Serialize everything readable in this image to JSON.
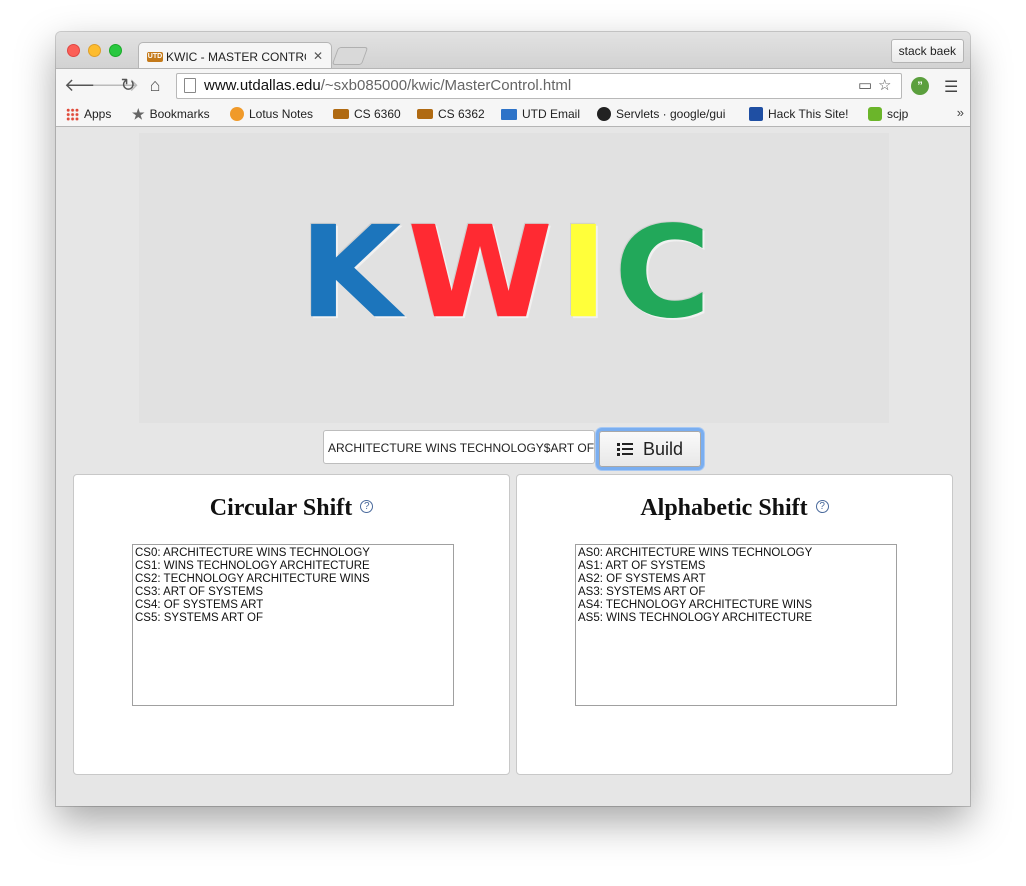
{
  "browser": {
    "tab_title": "KWIC - MASTER CONTROL",
    "tab_favicon_text": "UTD",
    "profile_name": "stack baek",
    "url_host": "www.utdallas.edu",
    "url_path": "/~sxb085000/kwic/MasterControl.html",
    "bookmarks": [
      {
        "label": "Apps",
        "icon": "apps-grid-icon"
      },
      {
        "label": "Bookmarks",
        "icon": "star-icon"
      },
      {
        "label": "Lotus Notes",
        "icon": "lotus-icon"
      },
      {
        "label": "CS 6360",
        "icon": "utd-icon"
      },
      {
        "label": "CS 6362",
        "icon": "utd-icon"
      },
      {
        "label": "UTD Email",
        "icon": "mail-icon"
      },
      {
        "label": "Servlets · google/gui",
        "icon": "github-icon"
      },
      {
        "label": "Hack This Site!",
        "icon": "hackthissite-icon"
      },
      {
        "label": "scjp",
        "icon": "blog-icon"
      }
    ],
    "more_label": "»"
  },
  "logo": {
    "letters": [
      "K",
      "W",
      "I",
      "C"
    ],
    "colors": [
      "#1c75bc",
      "#ff2a32",
      "#ffff3a",
      "#22a85a"
    ]
  },
  "input": {
    "value": "ARCHITECTURE WINS TECHNOLOGY$ART OF SY"
  },
  "build_button": {
    "label": "Build"
  },
  "circular_shift": {
    "title": "Circular Shift",
    "help_glyph": "?",
    "lines": [
      "CS0: ARCHITECTURE WINS TECHNOLOGY",
      "CS1: WINS TECHNOLOGY ARCHITECTURE",
      "CS2: TECHNOLOGY ARCHITECTURE WINS",
      "CS3: ART OF SYSTEMS",
      "CS4: OF SYSTEMS ART",
      "CS5: SYSTEMS ART OF"
    ]
  },
  "alphabetic_shift": {
    "title": "Alphabetic Shift",
    "help_glyph": "?",
    "lines": [
      "AS0: ARCHITECTURE WINS TECHNOLOGY",
      "AS1: ART OF SYSTEMS",
      "AS2: OF SYSTEMS ART",
      "AS3: SYSTEMS ART OF",
      "AS4: TECHNOLOGY ARCHITECTURE WINS",
      "AS5: WINS TECHNOLOGY ARCHITECTURE"
    ]
  }
}
